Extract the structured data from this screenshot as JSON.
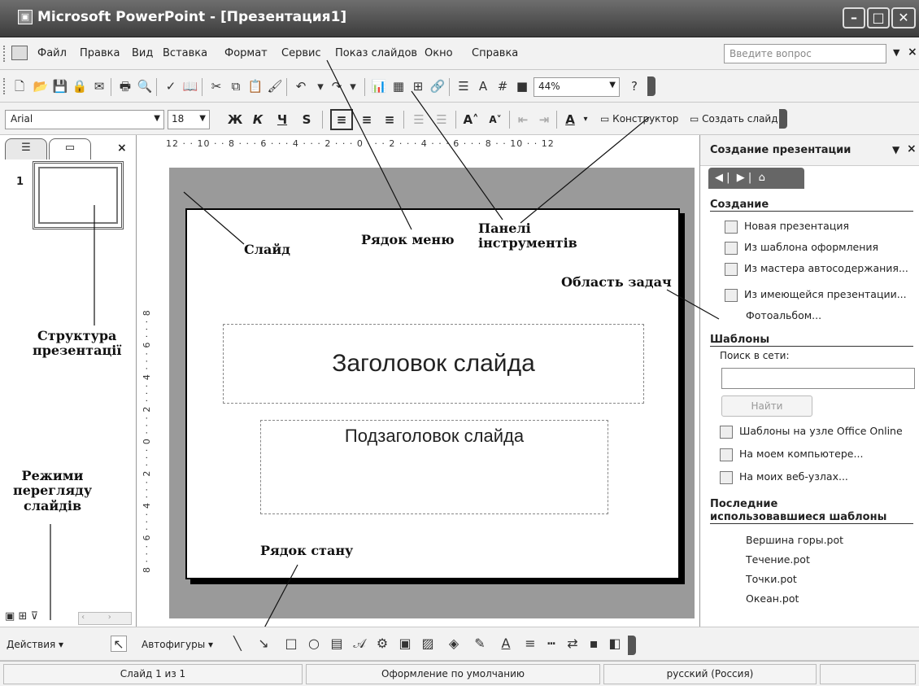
{
  "window": {
    "title": "Microsoft PowerPoint - [Презентация1]",
    "minimize": "–",
    "maximize": "□",
    "close": "✕"
  },
  "menubar": {
    "items": [
      "Файл",
      "Правка",
      "Вид",
      "Вставка",
      "Формат",
      "Сервис",
      "Показ слайдов",
      "Окно",
      "Справка"
    ],
    "help_placeholder": "Введите вопрос",
    "close": "×"
  },
  "standard_toolbar": {
    "zoom": "44%"
  },
  "formatting_toolbar": {
    "font": "Arial",
    "size": "18",
    "bold": "Ж",
    "italic": "К",
    "underline": "Ч",
    "shadow": "S",
    "designer": "Конструктор",
    "new_slide": "Создать слайд"
  },
  "outline_pane": {
    "slide_number": "1",
    "close": "×"
  },
  "editor": {
    "hruler": "12 · · 10 · · 8 · · · 6 · · · 4 · · · 2 · · · 0 · · · 2 · · · 4 · · · 6 · · · 8 · · 10 · · 12",
    "vruler": "8 · · · 6 · · · 4 · · · 2 · · · 0 · · · 2 · · · 4 · · · 6 · · · 8",
    "slide_title": "Заголовок слайда",
    "slide_subtitle": "Подзаголовок слайда"
  },
  "annotations": {
    "slide": "Слайд",
    "menu_row": "Рядок меню",
    "toolbars_1": "Панелі",
    "toolbars_2": "інструментів",
    "task_area": "Область задач",
    "structure_1": "Структура",
    "structure_2": "презентації",
    "view_modes_1": "Режими",
    "view_modes_2": "перегляду",
    "view_modes_3": "слайдів",
    "status_row": "Рядок стану"
  },
  "task_pane": {
    "title": "Создание презентации",
    "section_create": "Создание",
    "create_links": [
      "Новая презентация",
      "Из шаблона оформления",
      "Из мастера автосодержания...",
      "Из имеющейся презентации...",
      "Фотоальбом..."
    ],
    "section_templates": "Шаблоны",
    "search_label": "Поиск в сети:",
    "find_button": "Найти",
    "template_links": [
      "Шаблоны на узле Office Online",
      "На моем компьютере...",
      "На моих веб-узлах..."
    ],
    "section_recent_1": "Последние",
    "section_recent_2": "использовавшиеся шаблоны",
    "recent": [
      "Вершина горы.pot",
      "Течение.pot",
      "Точки.pot",
      "Океан.pot"
    ]
  },
  "drawing_toolbar": {
    "actions": "Действия ▾",
    "autoshapes": "Автофигуры ▾"
  },
  "statusbar": {
    "slide": "Слайд 1 из 1",
    "design": "Оформление по умолчанию",
    "language": "русский (Россия)"
  }
}
